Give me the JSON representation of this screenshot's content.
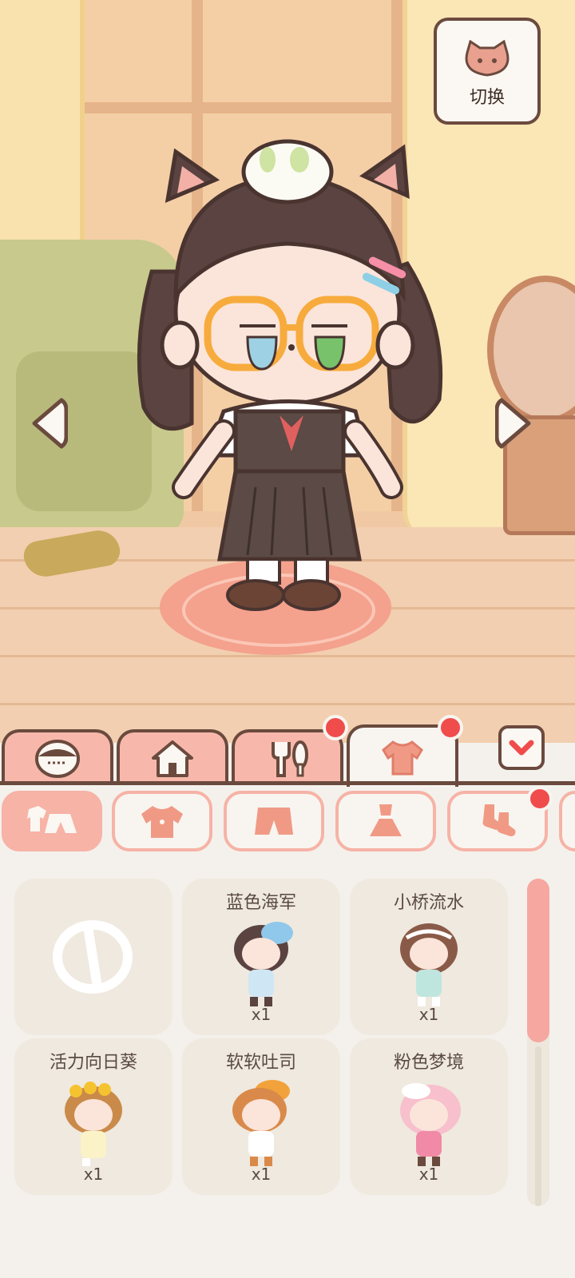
{
  "scene": {
    "character": "avatar",
    "switch_button": {
      "label": "切换",
      "icon": "cat-face-icon"
    }
  },
  "nav": {
    "prev_icon": "arrow-left-icon",
    "next_icon": "arrow-right-icon"
  },
  "tabs": [
    {
      "icon": "face-icon",
      "active": false,
      "badge": false
    },
    {
      "icon": "house-icon",
      "active": false,
      "badge": false
    },
    {
      "icon": "fork-spoon-icon",
      "active": false,
      "badge": true
    },
    {
      "icon": "shirt-icon",
      "active": true,
      "badge": true
    }
  ],
  "collapse_icon": "chevron-down-icon",
  "subcategories": [
    {
      "icon": "outfit-set-icon",
      "active": true,
      "badge": false
    },
    {
      "icon": "top-icon",
      "active": false,
      "badge": false
    },
    {
      "icon": "shorts-icon",
      "active": false,
      "badge": false
    },
    {
      "icon": "dress-icon",
      "active": false,
      "badge": false
    },
    {
      "icon": "socks-icon",
      "active": false,
      "badge": true
    }
  ],
  "items": [
    {
      "name": "",
      "count": "",
      "icon": "none-icon"
    },
    {
      "name": "蓝色海军",
      "count": "x1"
    },
    {
      "name": "小桥流水",
      "count": "x1"
    },
    {
      "name": "活力向日葵",
      "count": "x1"
    },
    {
      "name": "软软吐司",
      "count": "x1"
    },
    {
      "name": "粉色梦境",
      "count": "x1"
    }
  ],
  "colors": {
    "accent": "#f6b3a6",
    "outline": "#6b4a3e",
    "badge": "#f04c4c",
    "scroll_thumb": "#f5a7a0"
  },
  "scroll_position": 0.0
}
